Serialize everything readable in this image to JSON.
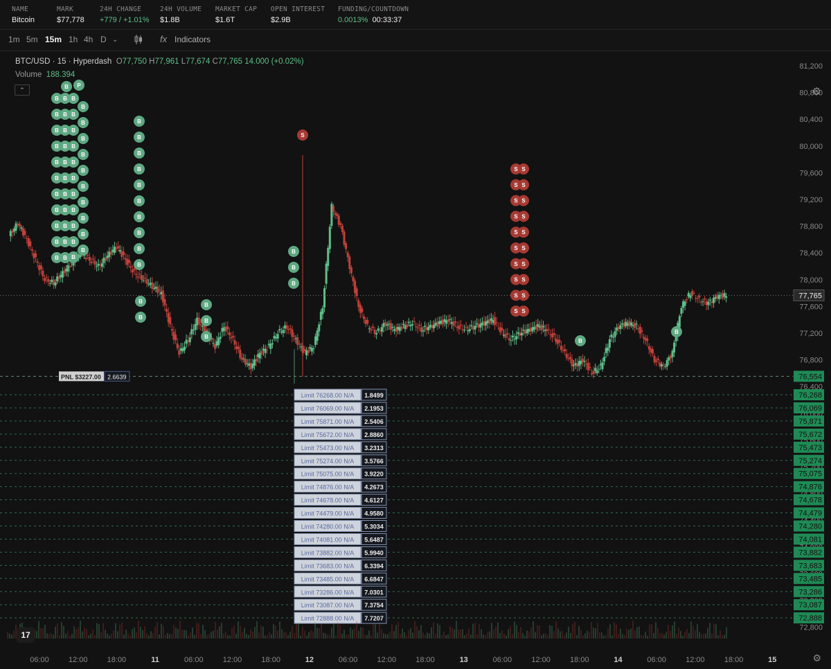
{
  "market": {
    "name_label": "NAME",
    "name": "Bitcoin",
    "mark_label": "MARK",
    "mark": "$77,778",
    "change_label": "24H CHANGE",
    "change": "+779 / +1.01%",
    "volume_label": "24H VOLUME",
    "volume": "$1.8B",
    "cap_label": "MARKET CAP",
    "cap": "$1.6T",
    "oi_label": "OPEN INTEREST",
    "oi": "$2.9B",
    "funding_label": "FUNDING/COUNTDOWN",
    "funding": "0.0013%",
    "countdown": "00:33:37"
  },
  "toolbar": {
    "timeframes": [
      "1m",
      "5m",
      "15m",
      "1h",
      "4h",
      "D"
    ],
    "active": "15m",
    "indicators_label": "Indicators"
  },
  "legend": {
    "symbol": "BTC/USD · 15 · Hyperdash",
    "o_label": "O",
    "o": "77,750",
    "h_label": "H",
    "h": "77,961",
    "l_label": "L",
    "l": "77,674",
    "c_label": "C",
    "c": "77,765",
    "change": "14.000 (+0.02%)",
    "volume_label": "Volume",
    "volume": "188.394"
  },
  "colors": {
    "up": "#5fbf8b",
    "down": "#c0413a",
    "buy_marker": "#5fa883",
    "sell_marker": "#a63a33",
    "price_tag": "#1f8a55",
    "order_line": "#2e6e4f"
  },
  "chart_data": {
    "type": "candlestick",
    "price_axis": [
      "81,200",
      "80,800",
      "80,400",
      "80,000",
      "79,600",
      "79,200",
      "78,800",
      "78,400",
      "78,000",
      "77,600",
      "77,200",
      "76,800",
      "76,400",
      "76,000",
      "75,600",
      "75,200",
      "74,800",
      "74,400",
      "74,000",
      "73,600",
      "73,200",
      "72,800"
    ],
    "time_axis": [
      "06:00",
      "12:00",
      "18:00",
      "11",
      "06:00",
      "12:00",
      "18:00",
      "12",
      "06:00",
      "12:00",
      "18:00",
      "13",
      "06:00",
      "12:00",
      "18:00",
      "14",
      "06:00",
      "12:00",
      "18:00",
      "15"
    ],
    "last_price": "77,765",
    "pnl_label": "PNL $3227.00",
    "pnl_size": "2.6639",
    "pnl_price": "76,554",
    "series": [
      {
        "name": "close",
        "points": [
          [
            0,
            78650
          ],
          [
            2,
            78850
          ],
          [
            4,
            78600
          ],
          [
            6,
            78300
          ],
          [
            8,
            78000
          ],
          [
            10,
            77950
          ],
          [
            12,
            78100
          ],
          [
            14,
            78250
          ],
          [
            16,
            78400
          ],
          [
            18,
            78300
          ],
          [
            20,
            78200
          ],
          [
            22,
            78350
          ],
          [
            24,
            78500
          ],
          [
            26,
            78300
          ],
          [
            28,
            78100
          ],
          [
            30,
            78000
          ],
          [
            32,
            77900
          ],
          [
            34,
            77800
          ],
          [
            36,
            77300
          ],
          [
            38,
            76900
          ],
          [
            40,
            77100
          ],
          [
            42,
            77400
          ],
          [
            44,
            77200
          ],
          [
            46,
            77000
          ],
          [
            48,
            77300
          ],
          [
            50,
            77100
          ],
          [
            52,
            76800
          ],
          [
            54,
            76700
          ],
          [
            56,
            76900
          ],
          [
            58,
            77000
          ],
          [
            60,
            77200
          ],
          [
            62,
            77300
          ],
          [
            64,
            77100
          ],
          [
            66,
            76900
          ],
          [
            68,
            77000
          ],
          [
            70,
            77600
          ],
          [
            72,
            79100
          ],
          [
            74,
            78800
          ],
          [
            76,
            78200
          ],
          [
            78,
            77600
          ],
          [
            80,
            77300
          ],
          [
            82,
            77200
          ],
          [
            84,
            77350
          ],
          [
            86,
            77250
          ],
          [
            88,
            77300
          ],
          [
            90,
            77350
          ],
          [
            92,
            77250
          ],
          [
            94,
            77300
          ],
          [
            96,
            77350
          ],
          [
            98,
            77400
          ],
          [
            100,
            77300
          ],
          [
            102,
            77250
          ],
          [
            104,
            77300
          ],
          [
            106,
            77350
          ],
          [
            108,
            77400
          ],
          [
            110,
            77200
          ],
          [
            112,
            77100
          ],
          [
            114,
            77200
          ],
          [
            116,
            77250
          ],
          [
            118,
            77300
          ],
          [
            120,
            77250
          ],
          [
            122,
            77100
          ],
          [
            124,
            76900
          ],
          [
            126,
            76700
          ],
          [
            128,
            76800
          ],
          [
            130,
            76600
          ],
          [
            132,
            76700
          ],
          [
            134,
            77100
          ],
          [
            136,
            77300
          ],
          [
            138,
            77350
          ],
          [
            140,
            77300
          ],
          [
            142,
            77100
          ],
          [
            144,
            76800
          ],
          [
            146,
            76700
          ],
          [
            148,
            76900
          ],
          [
            150,
            77600
          ],
          [
            152,
            77800
          ],
          [
            154,
            77700
          ],
          [
            156,
            77650
          ],
          [
            158,
            77750
          ],
          [
            160,
            77765
          ]
        ]
      }
    ],
    "buy_markers_price": [
      "77,600",
      "77,400",
      "77,200",
      "76,900"
    ],
    "limit_orders": [
      {
        "label": "Limit 76268.00 N/A",
        "size": "1.8499",
        "price": "76,268"
      },
      {
        "label": "Limit 76069.00 N/A",
        "size": "2.1953",
        "price": "76,069"
      },
      {
        "label": "Limit 75871.00 N/A",
        "size": "2.5406",
        "price": "75,871"
      },
      {
        "label": "Limit 75672.00 N/A",
        "size": "2.8860",
        "price": "75,672"
      },
      {
        "label": "Limit 75473.00 N/A",
        "size": "3.2313",
        "price": "75,473"
      },
      {
        "label": "Limit 75274.00 N/A",
        "size": "3.5766",
        "price": "75,274"
      },
      {
        "label": "Limit 75075.00 N/A",
        "size": "3.9220",
        "price": "75,075"
      },
      {
        "label": "Limit 74876.00 N/A",
        "size": "4.2673",
        "price": "74,876"
      },
      {
        "label": "Limit 74678.00 N/A",
        "size": "4.6127",
        "price": "74,678"
      },
      {
        "label": "Limit 74479.00 N/A",
        "size": "4.9580",
        "price": "74,479"
      },
      {
        "label": "Limit 74280.00 N/A",
        "size": "5.3034",
        "price": "74,280"
      },
      {
        "label": "Limit 74081.00 N/A",
        "size": "5.6487",
        "price": "74,081"
      },
      {
        "label": "Limit 73882.00 N/A",
        "size": "5.9940",
        "price": "73,882"
      },
      {
        "label": "Limit 73683.00 N/A",
        "size": "6.3394",
        "price": "73,683"
      },
      {
        "label": "Limit 73485.00 N/A",
        "size": "6.6847",
        "price": "73,485"
      },
      {
        "label": "Limit 73286.00 N/A",
        "size": "7.0301",
        "price": "73,286"
      },
      {
        "label": "Limit 73087.00 N/A",
        "size": "7.3754",
        "price": "73,087"
      },
      {
        "label": "Limit 72888.00 N/A",
        "size": "7.7207",
        "price": "72,888"
      }
    ]
  }
}
